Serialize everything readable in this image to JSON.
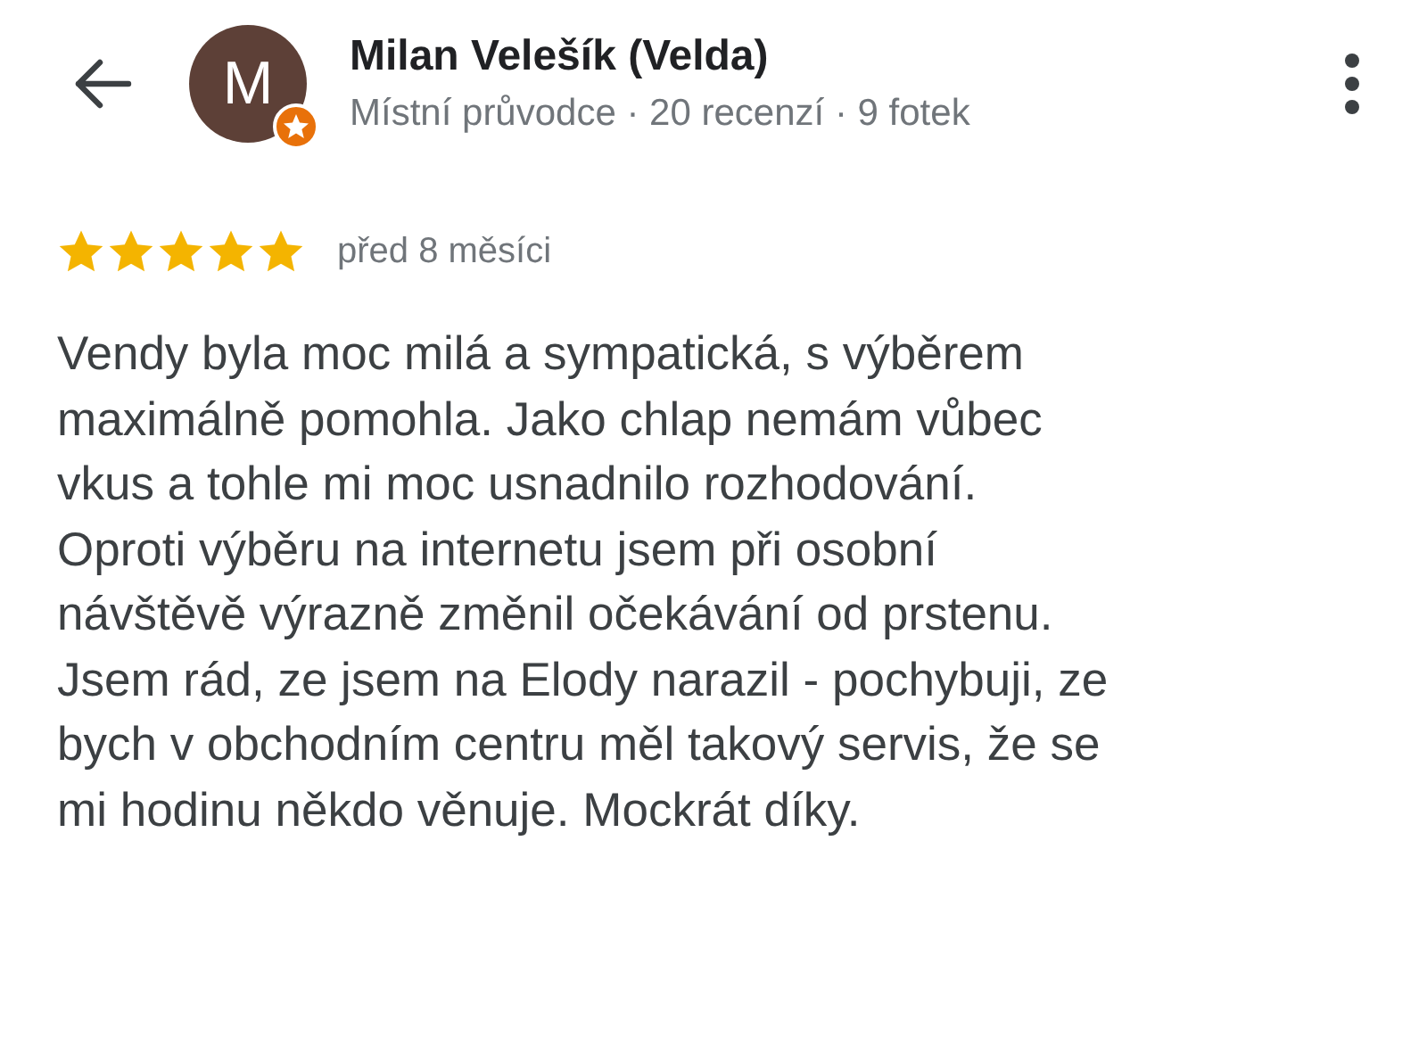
{
  "header": {
    "avatar_letter": "M",
    "name": "Milan Velešík (Velda)",
    "subtitle": "Místní průvodce · 20 recenzí · 9 fotek"
  },
  "review": {
    "stars": 5,
    "time": "před 8 měsíci",
    "lines": [
      "Vendy byla moc milá a sympatická, s výběrem",
      "maximálně pomohla. Jako chlap nemám vůbec",
      "vkus a tohle mi moc usnadnilo rozhodování.",
      "Oproti výběru na internetu jsem při osobní",
      "návštěvě výrazně změnil očekávání od prstenu.",
      "Jsem rád, ze jsem na Elody narazil - pochybuji, ze",
      "bych v obchodním centru měl takový servis, že se",
      "mi hodinu někdo věnuje. Mockrát díky."
    ]
  }
}
